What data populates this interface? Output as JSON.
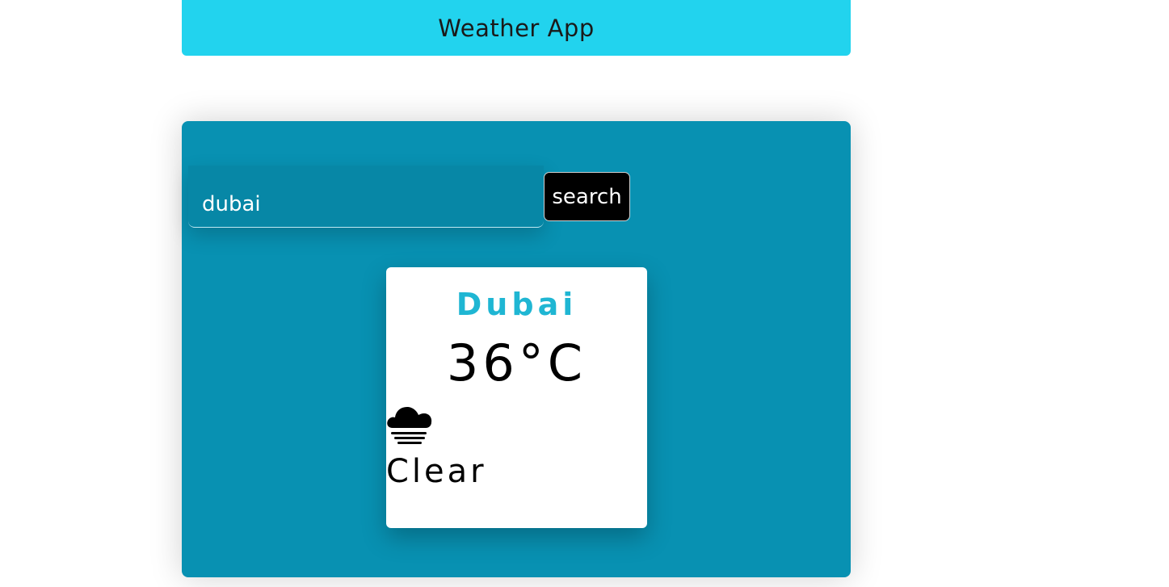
{
  "header": {
    "title": "Weather App"
  },
  "search": {
    "value": "dubai",
    "button_label": "search"
  },
  "weather": {
    "city": "Dubai",
    "temperature": "36°C",
    "condition": "Clear",
    "icon": "cloud-fog-icon"
  },
  "colors": {
    "header_bg": "#22d3ee",
    "panel_bg": "#0891b2",
    "city_text": "#1fb6d3",
    "button_bg": "#000000"
  }
}
